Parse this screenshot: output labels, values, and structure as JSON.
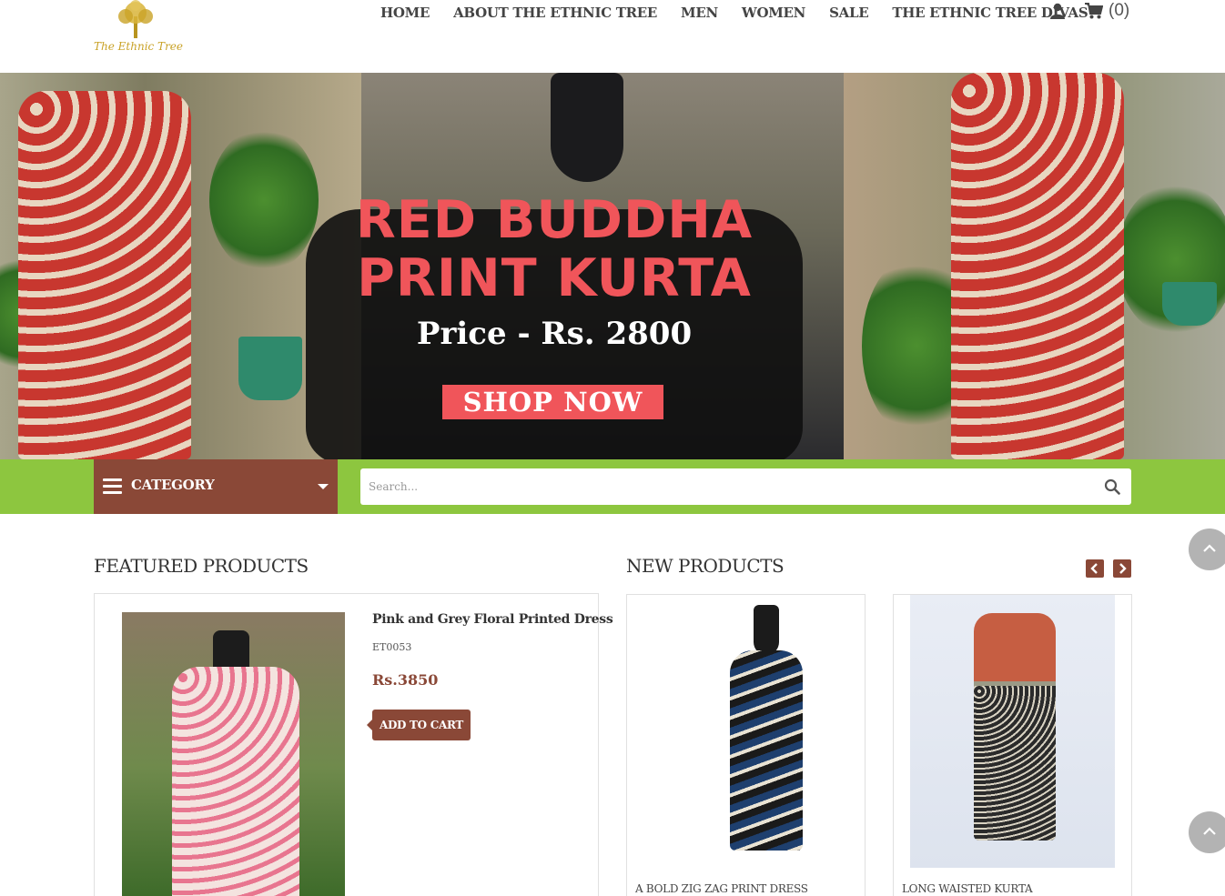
{
  "brand": {
    "logo_text": "The Ethnic Tree"
  },
  "nav": {
    "items": [
      "HOME",
      "ABOUT THE ETHNIC TREE",
      "MEN",
      "WOMEN",
      "SALE",
      "THE ETHNIC TREE DIVAS"
    ],
    "user_icon": "user-icon",
    "cart_icon": "cart-icon",
    "cart_count": "(0)"
  },
  "banner": {
    "headline_line1": "RED BUDDHA",
    "headline_line2": "PRINT KURTA",
    "price": "Price - Rs. 2800",
    "cta": "SHOP NOW",
    "accent_color": "#f0555a"
  },
  "category_bar": {
    "label": "CATEGORY",
    "menu_icon": "hamburger-icon",
    "dropdown_icon": "caret-down-icon",
    "bar_color": "#8dc63f",
    "category_color": "#8a4837"
  },
  "search": {
    "placeholder": "Search...",
    "icon": "search-icon"
  },
  "featured": {
    "title": "FEATURED PRODUCTS",
    "product": {
      "name": "Pink and Grey Floral Printed Dress",
      "sku": "ET0053",
      "price": "Rs.3850",
      "button": "ADD TO CART"
    }
  },
  "new_products": {
    "title": "NEW PRODUCTS",
    "prev_icon": "chevron-left-icon",
    "next_icon": "chevron-right-icon",
    "items": [
      {
        "name": "A BOLD ZIG ZAG PRINT DRESS"
      },
      {
        "name": "LONG WAISTED KURTA"
      }
    ]
  },
  "scroll_top_icon": "chevron-up-icon"
}
